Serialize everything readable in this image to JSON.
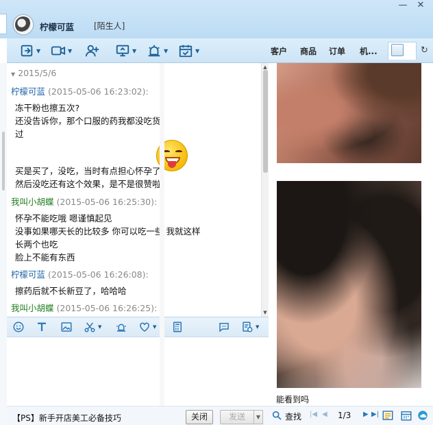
{
  "window": {
    "contact_name": "柠檬可蓝",
    "contact_tag": "[陌生人]",
    "controls": [
      "—",
      "✕"
    ]
  },
  "toolbar": {
    "tabs": [
      "客户",
      "商品",
      "订单",
      "机..."
    ]
  },
  "chat": {
    "date": "2015/5/6",
    "messages": [
      {
        "sender": "柠檬可蓝",
        "time": "(2015-05-06 16:23:02):",
        "lines": [
          "冻干粉也擦五次?",
          "还没告诉你，那个口服的药我都没吃货",
          "过",
          "",
          "买是买了，没吃，当时有点担心怀孕了",
          "然后没吃还有这个效果，是不是很赞啦"
        ]
      },
      {
        "sender": "我叫小胡蝶",
        "time": "(2015-05-06 16:25:30):",
        "lines": [
          "怀孕不能吃哦 嗯谨慎起见",
          "没事如果哪天长的比较多 你可以吃一些 我就这样",
          "长两个也吃",
          "脸上不能有东西"
        ]
      },
      {
        "sender": "柠檬可蓝",
        "time": "(2015-05-06 16:26:08):",
        "lines": [
          "擦药后就不长新豆了，哈哈哈"
        ]
      },
      {
        "sender": "我叫小胡蝶",
        "time": "(2015-05-06 16:26:25):",
        "lines": []
      }
    ]
  },
  "footer": {
    "tip": "【PS】新手开店美工必备技巧",
    "close_label": "关闭",
    "send_label": "发送"
  },
  "viewer": {
    "caption": "能看到吗",
    "search_label": "查找",
    "page": "1/3"
  },
  "colors": {
    "sender_self": "#2366a8",
    "sender_other": "#1f7d1f",
    "accent": "#2b78b8"
  }
}
